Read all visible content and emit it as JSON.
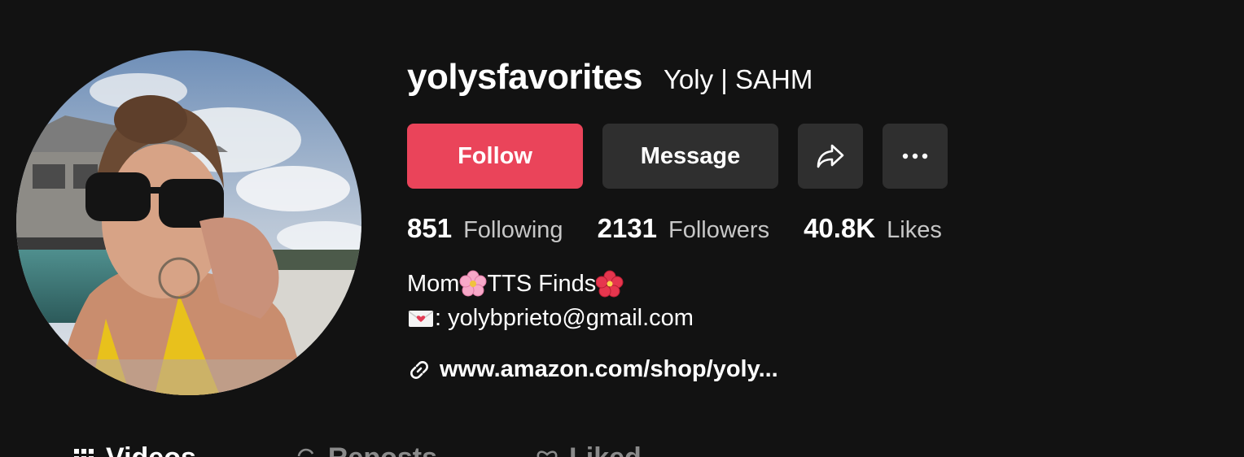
{
  "profile": {
    "username": "yolysfavorites",
    "nickname": "Yoly | SAHM",
    "avatar_alt": "profile-photo"
  },
  "actions": {
    "follow_label": "Follow",
    "message_label": "Message",
    "share_icon": "share-icon",
    "more_icon": "more-icon"
  },
  "stats": [
    {
      "value": "851",
      "label": "Following"
    },
    {
      "value": "2131",
      "label": "Followers"
    },
    {
      "value": "40.8K",
      "label": "Likes"
    }
  ],
  "bio": {
    "line1_a": "Mom",
    "line1_b": "TTS Finds",
    "line2": ": yolybprieto@gmail.com"
  },
  "link": {
    "text": "www.amazon.com/shop/yoly..."
  },
  "tabs": [
    {
      "label": "Videos",
      "icon": "grid-icon"
    },
    {
      "label": "Reposts",
      "icon": "repost-icon"
    },
    {
      "label": "Liked",
      "icon": "heart-icon"
    }
  ],
  "colors": {
    "background": "#121212",
    "follow": "#ea445a",
    "secondary_button": "#2f2f2f",
    "muted_text": "#c7c7c7"
  }
}
